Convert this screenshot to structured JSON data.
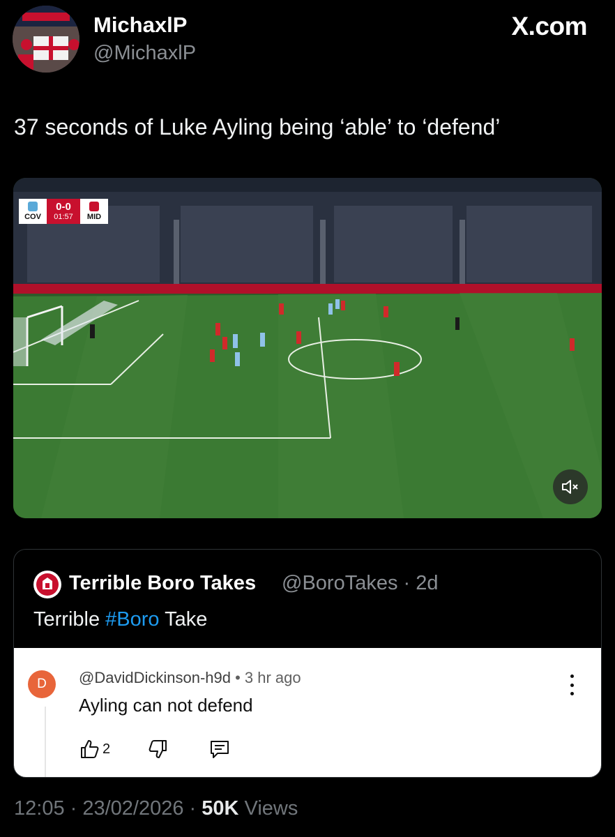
{
  "author": {
    "display_name": "MichaxlP",
    "handle": "@MichaxlP"
  },
  "site_mark": "X.com",
  "tweet_text": "37 seconds of Luke Ayling being ‘able’ to ‘defend’",
  "video": {
    "scorebug": {
      "home": "COV",
      "score": "0-0",
      "clock": "01:57",
      "away": "MID"
    },
    "icon": "volume-muted-icon"
  },
  "quote": {
    "display_name": "Terrible Boro Takes",
    "handle_time": "@BoroTakes · 2d",
    "text_prefix": "Terrible ",
    "hashtag": "#Boro",
    "text_suffix": " Take",
    "comment": {
      "avatar_letter": "D",
      "user": "@DavidDickinson-h9d",
      "time": " • 3 hr ago",
      "text": "Ayling can not defend",
      "likes": "2"
    }
  },
  "footer": {
    "time_date": "12:05 · 23/02/2026 · ",
    "views_count": "50K",
    "views_label": " Views"
  },
  "colors": {
    "background": "#000000",
    "link": "#1d9bf0",
    "muted": "#71767b",
    "comment_avatar": "#e8653a"
  }
}
